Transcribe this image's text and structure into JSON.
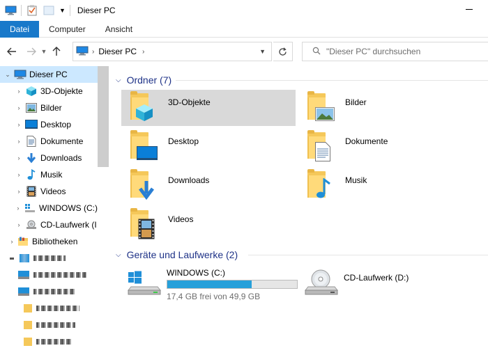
{
  "window": {
    "title": "Dieser PC"
  },
  "ribbon": {
    "tabs": [
      "Datei",
      "Computer",
      "Ansicht"
    ]
  },
  "address": {
    "breadcrumb": "Dieser PC",
    "search_placeholder": "\"Dieser PC\" durchsuchen"
  },
  "navpane": {
    "items": [
      {
        "label": "Dieser PC",
        "icon": "this-pc-icon"
      },
      {
        "label": "3D-Objekte",
        "icon": "3d-objects-icon"
      },
      {
        "label": "Bilder",
        "icon": "pictures-icon"
      },
      {
        "label": "Desktop",
        "icon": "desktop-icon"
      },
      {
        "label": "Dokumente",
        "icon": "documents-icon"
      },
      {
        "label": "Downloads",
        "icon": "downloads-icon"
      },
      {
        "label": "Musik",
        "icon": "music-icon"
      },
      {
        "label": "Videos",
        "icon": "videos-icon"
      },
      {
        "label": "WINDOWS (C:)",
        "icon": "drive-icon"
      },
      {
        "label": "CD-Laufwerk (I",
        "icon": "cd-drive-icon"
      },
      {
        "label": "Bibliotheken",
        "icon": "libraries-icon"
      }
    ]
  },
  "content": {
    "folders_header": "Ordner (7)",
    "folders": [
      {
        "label": "3D-Objekte",
        "icon": "3d-objects-icon"
      },
      {
        "label": "Bilder",
        "icon": "pictures-icon"
      },
      {
        "label": "Desktop",
        "icon": "desktop-icon"
      },
      {
        "label": "Dokumente",
        "icon": "documents-icon"
      },
      {
        "label": "Downloads",
        "icon": "downloads-icon"
      },
      {
        "label": "Musik",
        "icon": "music-icon"
      },
      {
        "label": "Videos",
        "icon": "videos-icon"
      }
    ],
    "drives_header": "Geräte und Laufwerke (2)",
    "drives": [
      {
        "label": "WINDOWS (C:)",
        "free_text": "17,4 GB frei von 49,9 GB",
        "used_fraction": 0.65
      },
      {
        "label": "CD-Laufwerk (D:)"
      }
    ]
  },
  "colors": {
    "accent": "#1979ca",
    "selection": "#cce8ff",
    "group_header": "#1e3287",
    "drive_fill": "#26a0da",
    "folder": "#ffda7a"
  }
}
